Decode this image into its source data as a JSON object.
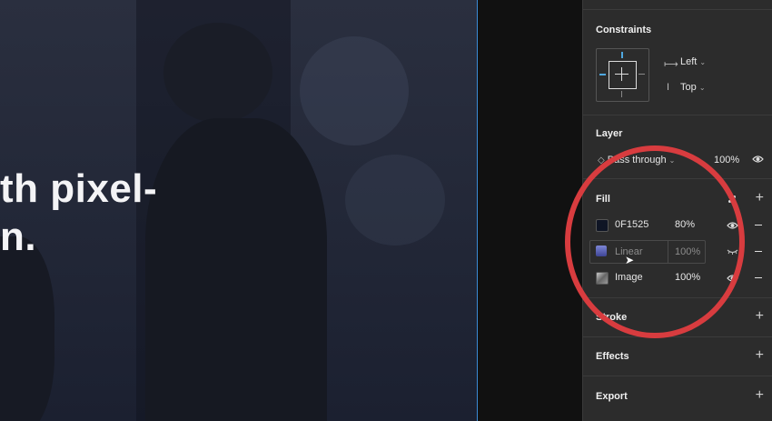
{
  "canvas": {
    "hero_line1": "th pixel-",
    "hero_line2": "n."
  },
  "panel": {
    "constraints": {
      "title": "Constraints",
      "horizontal": "Left",
      "vertical": "Top"
    },
    "layer": {
      "title": "Layer",
      "blend_mode": "Pass through",
      "opacity": "100%"
    },
    "fill": {
      "title": "Fill",
      "items": [
        {
          "name": "0F1525",
          "opacity": "80%",
          "swatch_color": "#0f1525",
          "visible": true
        },
        {
          "name": "Linear",
          "opacity": "100%",
          "swatch_color": "#5a63b5",
          "visible": false
        },
        {
          "name": "Image",
          "opacity": "100%",
          "swatch_color": "#888888",
          "visible": true
        }
      ]
    },
    "stroke": {
      "title": "Stroke"
    },
    "effects": {
      "title": "Effects"
    },
    "export": {
      "title": "Export"
    }
  },
  "colors": {
    "annotation_circle": "#d83c3f",
    "selection_accent": "#3a8bd6",
    "constraint_active": "#4fa8e0"
  }
}
